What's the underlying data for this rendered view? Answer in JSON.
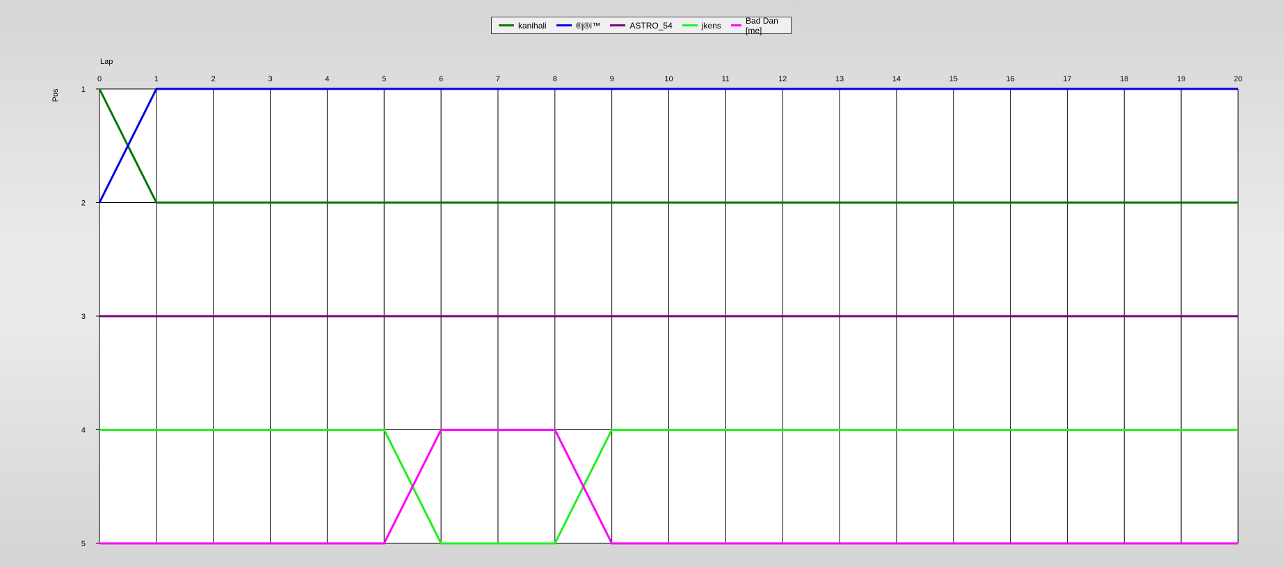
{
  "chart_data": {
    "type": "line",
    "xlabel": "Lap",
    "ylabel": "Pos",
    "x": [
      0,
      1,
      2,
      3,
      4,
      5,
      6,
      7,
      8,
      9,
      10,
      11,
      12,
      13,
      14,
      15,
      16,
      17,
      18,
      19,
      20
    ],
    "yticks": [
      1,
      2,
      3,
      4,
      5
    ],
    "xlim": [
      0,
      20
    ],
    "ylim": [
      1,
      5
    ],
    "y_inverted": true,
    "grid": true,
    "legend_position": "top-center",
    "series": [
      {
        "name": "kanihali",
        "color": "#007800",
        "values": [
          1,
          2,
          2,
          2,
          2,
          2,
          2,
          2,
          2,
          2,
          2,
          2,
          2,
          2,
          2,
          2,
          2,
          2,
          2,
          2,
          2
        ]
      },
      {
        "name": "®j®ì™",
        "color": "#0000e6",
        "values": [
          2,
          1,
          1,
          1,
          1,
          1,
          1,
          1,
          1,
          1,
          1,
          1,
          1,
          1,
          1,
          1,
          1,
          1,
          1,
          1,
          1
        ]
      },
      {
        "name": "ASTRO_54",
        "color": "#780078",
        "values": [
          3,
          3,
          3,
          3,
          3,
          3,
          3,
          3,
          3,
          3,
          3,
          3,
          3,
          3,
          3,
          3,
          3,
          3,
          3,
          3,
          3
        ]
      },
      {
        "name": "jkens",
        "color": "#20f020",
        "values": [
          4,
          4,
          4,
          4,
          4,
          4,
          5,
          5,
          5,
          4,
          4,
          4,
          4,
          4,
          4,
          4,
          4,
          4,
          4,
          4,
          4
        ]
      },
      {
        "name": "Bad Dan [me]",
        "color": "#ff00ff",
        "values": [
          5,
          5,
          5,
          5,
          5,
          5,
          4,
          4,
          4,
          5,
          5,
          5,
          5,
          5,
          5,
          5,
          5,
          5,
          5,
          5,
          5
        ]
      }
    ]
  }
}
